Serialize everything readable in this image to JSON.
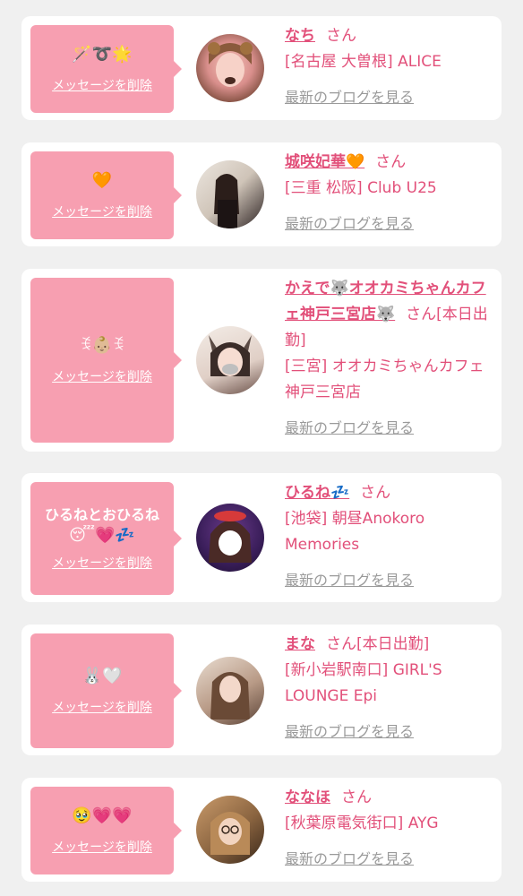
{
  "san": "さん",
  "delete_label": "メッセージを削除",
  "blog_label": "最新のブログを見る",
  "entries": [
    {
      "message": "🪄➰🌟",
      "name": "なち",
      "status": "",
      "area": "名古屋 大曽根",
      "shop": "ALICE"
    },
    {
      "message": "🧡",
      "name": "城咲妃華🧡",
      "status": "",
      "area": "三重 松阪",
      "shop": "Club U25"
    },
    {
      "message": "ꉂ👶🏼ꉂ",
      "name": "かえで🐺オオカミちゃんカフェ神戸三宮店🐺",
      "status": "[本日出勤]",
      "area": "三宮",
      "shop": "オオカミちゃんカフェ神戸三宮店"
    },
    {
      "message_text": "ひるねとおひるね",
      "message": "😴💗💤",
      "name": "ひるね💤",
      "status": "",
      "area": "池袋",
      "shop": "朝昼Anokoro Memories"
    },
    {
      "message": "🐰🤍",
      "name": "まな",
      "status": "[本日出勤]",
      "area": "新小岩駅南口",
      "shop": "GIRL'S LOUNGE Epi"
    },
    {
      "message": "🥹💗💗",
      "name": "ななほ",
      "status": "",
      "area": "秋葉原電気街口",
      "shop": "AYG"
    }
  ]
}
